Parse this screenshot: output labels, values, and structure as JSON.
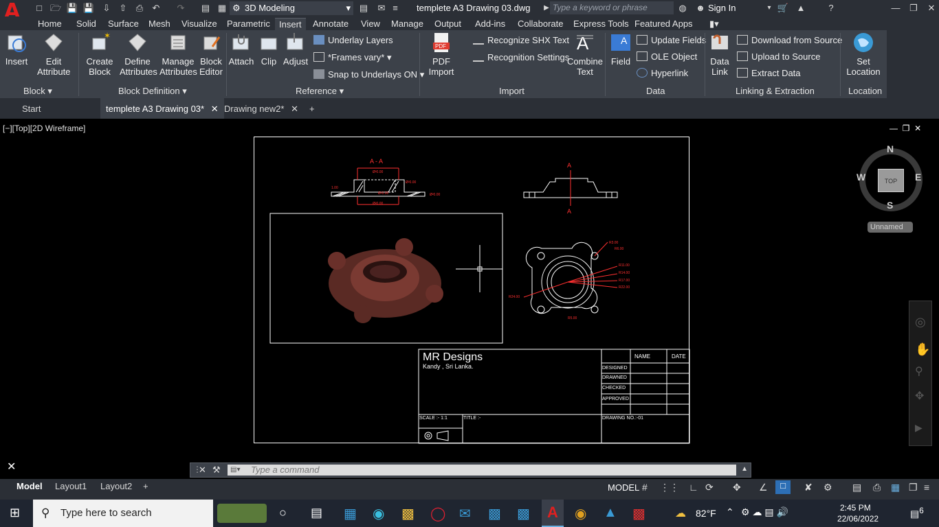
{
  "titlebar": {
    "workspace": "3D Modeling",
    "doc_title": "templete A3 Drawing 03.dwg",
    "search_placeholder": "Type a keyword or phrase",
    "signin": "Sign In"
  },
  "ribbon_tabs": [
    "Home",
    "Solid",
    "Surface",
    "Mesh",
    "Visualize",
    "Parametric",
    "Insert",
    "Annotate",
    "View",
    "Manage",
    "Output",
    "Add-ins",
    "Collaborate",
    "Express Tools",
    "Featured Apps"
  ],
  "active_tab": "Insert",
  "ribbon": {
    "block": {
      "title": "Block",
      "insert": "Insert",
      "edit_attr_1": "Edit",
      "edit_attr_2": "Attribute"
    },
    "block_definition": {
      "title": "Block Definition",
      "create_1": "Create",
      "create_2": "Block",
      "define_1": "Define",
      "define_2": "Attributes",
      "manage_1": "Manage",
      "manage_2": "Attributes",
      "editor_1": "Block",
      "editor_2": "Editor"
    },
    "reference": {
      "title": "Reference",
      "attach": "Attach",
      "clip": "Clip",
      "adjust": "Adjust",
      "underlay_layers": "Underlay Layers",
      "frames_vary": "*Frames vary*",
      "snap_underlays": "Snap to Underlays ON"
    },
    "import": {
      "title": "Import",
      "pdf_1": "PDF",
      "pdf_2": "Import",
      "recognize_shx": "Recognize SHX Text",
      "recognition_settings": "Recognition Settings",
      "combine_1": "Combine",
      "combine_2": "Text"
    },
    "data": {
      "title": "Data",
      "field": "Field",
      "update_fields": "Update Fields",
      "ole_object": "OLE Object",
      "hyperlink": "Hyperlink"
    },
    "linking": {
      "title": "Linking & Extraction",
      "data_link_1": "Data",
      "data_link_2": "Link",
      "download": "Download from Source",
      "upload": "Upload to Source",
      "extract": "Extract  Data"
    },
    "location": {
      "title": "Location",
      "set_1": "Set",
      "set_2": "Location"
    }
  },
  "doc_tabs": [
    "Start",
    "templete A3 Drawing 03*",
    "Drawing new2*"
  ],
  "viewport_label": "[−][Top][2D Wireframe]",
  "navcube": {
    "top": "TOP",
    "n": "N",
    "s": "S",
    "e": "E",
    "w": "W",
    "ucs": "Unnamed"
  },
  "drawing": {
    "section_label": "A - A",
    "arrow_label_top": "A",
    "arrow_label_bottom": "A",
    "dims_section": [
      "Ø²0.00",
      "Ø²0.00",
      "Ø²0.00",
      "1.00",
      "Ø²0.00",
      "Ø²0.00"
    ],
    "dims_plan": [
      "R3.00",
      "R6.00",
      "R11.00",
      "R14.00",
      "R17.00",
      "R22.00",
      "R24.00",
      "R5.00"
    ]
  },
  "title_block": {
    "company": "MR Designs",
    "location": "Kandy , Sri Lanka.",
    "col_name": "NAME",
    "col_date": "DATE",
    "rows": [
      "DESIGNED",
      "DRAWNED",
      "CHECKED",
      "APPROVED"
    ],
    "scale": "SCALE :- 1:1",
    "title": "TITLE :-",
    "drawing_no": "DRAWING NO.:-01"
  },
  "command": {
    "placeholder": "Type a command"
  },
  "layout_tabs": [
    "Model",
    "Layout1",
    "Layout2"
  ],
  "status": {
    "model": "MODEL"
  },
  "taskbar": {
    "search": "Type here to search",
    "weather": "82°F",
    "time": "2:45 PM",
    "date": "22/06/2022",
    "notifications": "6"
  },
  "colors": {
    "accent": "#e02020",
    "ribbon": "#3c4149",
    "titlebar": "#2b2f36",
    "dims": "#ff3030"
  }
}
